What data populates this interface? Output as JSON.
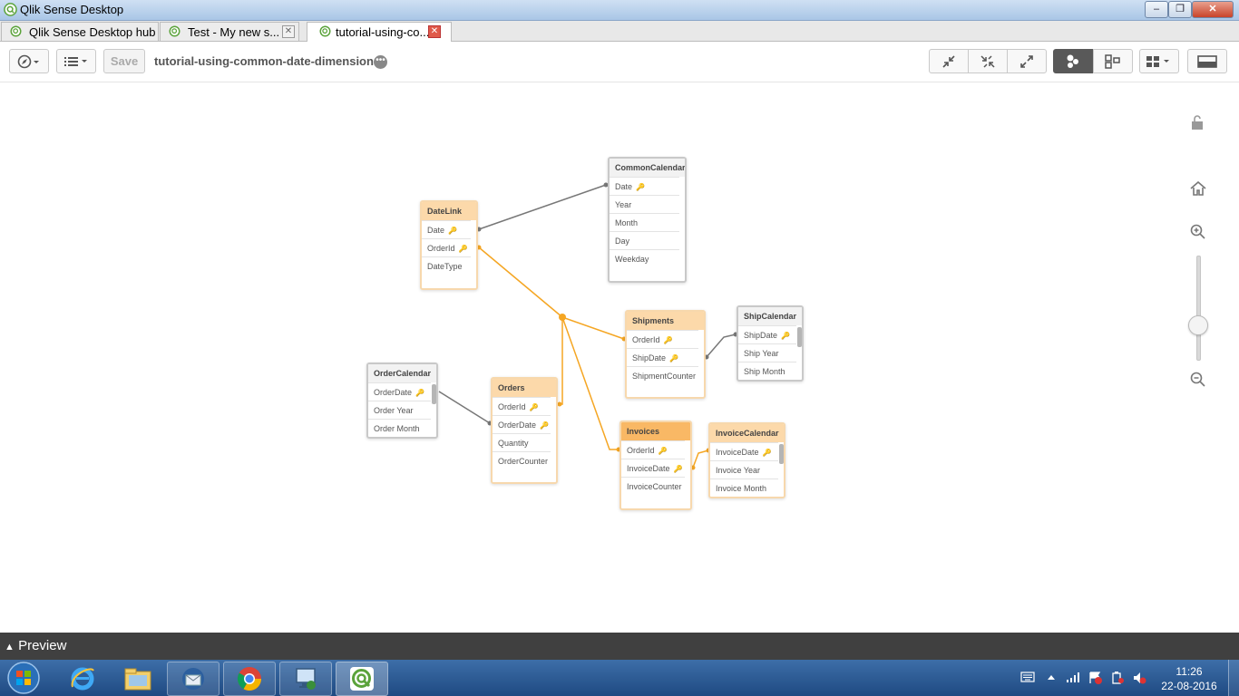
{
  "window": {
    "title": "Qlik Sense Desktop",
    "minimize": "–",
    "restore": "❐",
    "close": "✕"
  },
  "tabs": [
    {
      "label": "Qlik Sense Desktop hub"
    },
    {
      "label": "Test - My new s..."
    },
    {
      "label": "tutorial-using-co..."
    }
  ],
  "toolbar": {
    "save_label": "Save",
    "app_title": "tutorial-using-common-date-dimensions",
    "more": "•••"
  },
  "model": {
    "tables": {
      "commoncalendar": {
        "name": "CommonCalendar",
        "fields": [
          "Date",
          "Year",
          "Month",
          "Day",
          "Weekday"
        ]
      },
      "datelink": {
        "name": "DateLink",
        "fields": [
          "Date",
          "OrderId",
          "DateType"
        ]
      },
      "shipments": {
        "name": "Shipments",
        "fields": [
          "OrderId",
          "ShipDate",
          "ShipmentCounter"
        ]
      },
      "shipcalendar": {
        "name": "ShipCalendar",
        "fields": [
          "ShipDate",
          "Ship Year",
          "Ship Month"
        ]
      },
      "ordercalendar": {
        "name": "OrderCalendar",
        "fields": [
          "OrderDate",
          "Order Year",
          "Order Month"
        ]
      },
      "orders": {
        "name": "Orders",
        "fields": [
          "OrderId",
          "OrderDate",
          "Quantity",
          "OrderCounter"
        ]
      },
      "invoices": {
        "name": "Invoices",
        "fields": [
          "OrderId",
          "InvoiceDate",
          "InvoiceCounter"
        ]
      },
      "invoicecalendar": {
        "name": "InvoiceCalendar",
        "fields": [
          "InvoiceDate",
          "Invoice Year",
          "Invoice Month"
        ]
      }
    },
    "key_fields": {
      "commoncalendar": [
        "Date"
      ],
      "datelink": [
        "Date",
        "OrderId"
      ],
      "shipments": [
        "OrderId",
        "ShipDate"
      ],
      "shipcalendar": [
        "ShipDate"
      ],
      "ordercalendar": [
        "OrderDate"
      ],
      "orders": [
        "OrderId",
        "OrderDate"
      ],
      "invoices": [
        "OrderId",
        "InvoiceDate"
      ],
      "invoicecalendar": [
        "InvoiceDate"
      ]
    },
    "key_symbol": "🔑",
    "link_color_key": "#f5a623",
    "link_color_plain": "#777777"
  },
  "preview": {
    "label": "Preview",
    "arrow": "▲"
  },
  "taskbar": {
    "clock_time": "11:26",
    "clock_date": "22-08-2016"
  },
  "colors": {
    "selected_header": "#f9b865",
    "associated_header": "#fcd9aa",
    "preview_bar": "#404040",
    "taskbar": "#2b5a94"
  }
}
